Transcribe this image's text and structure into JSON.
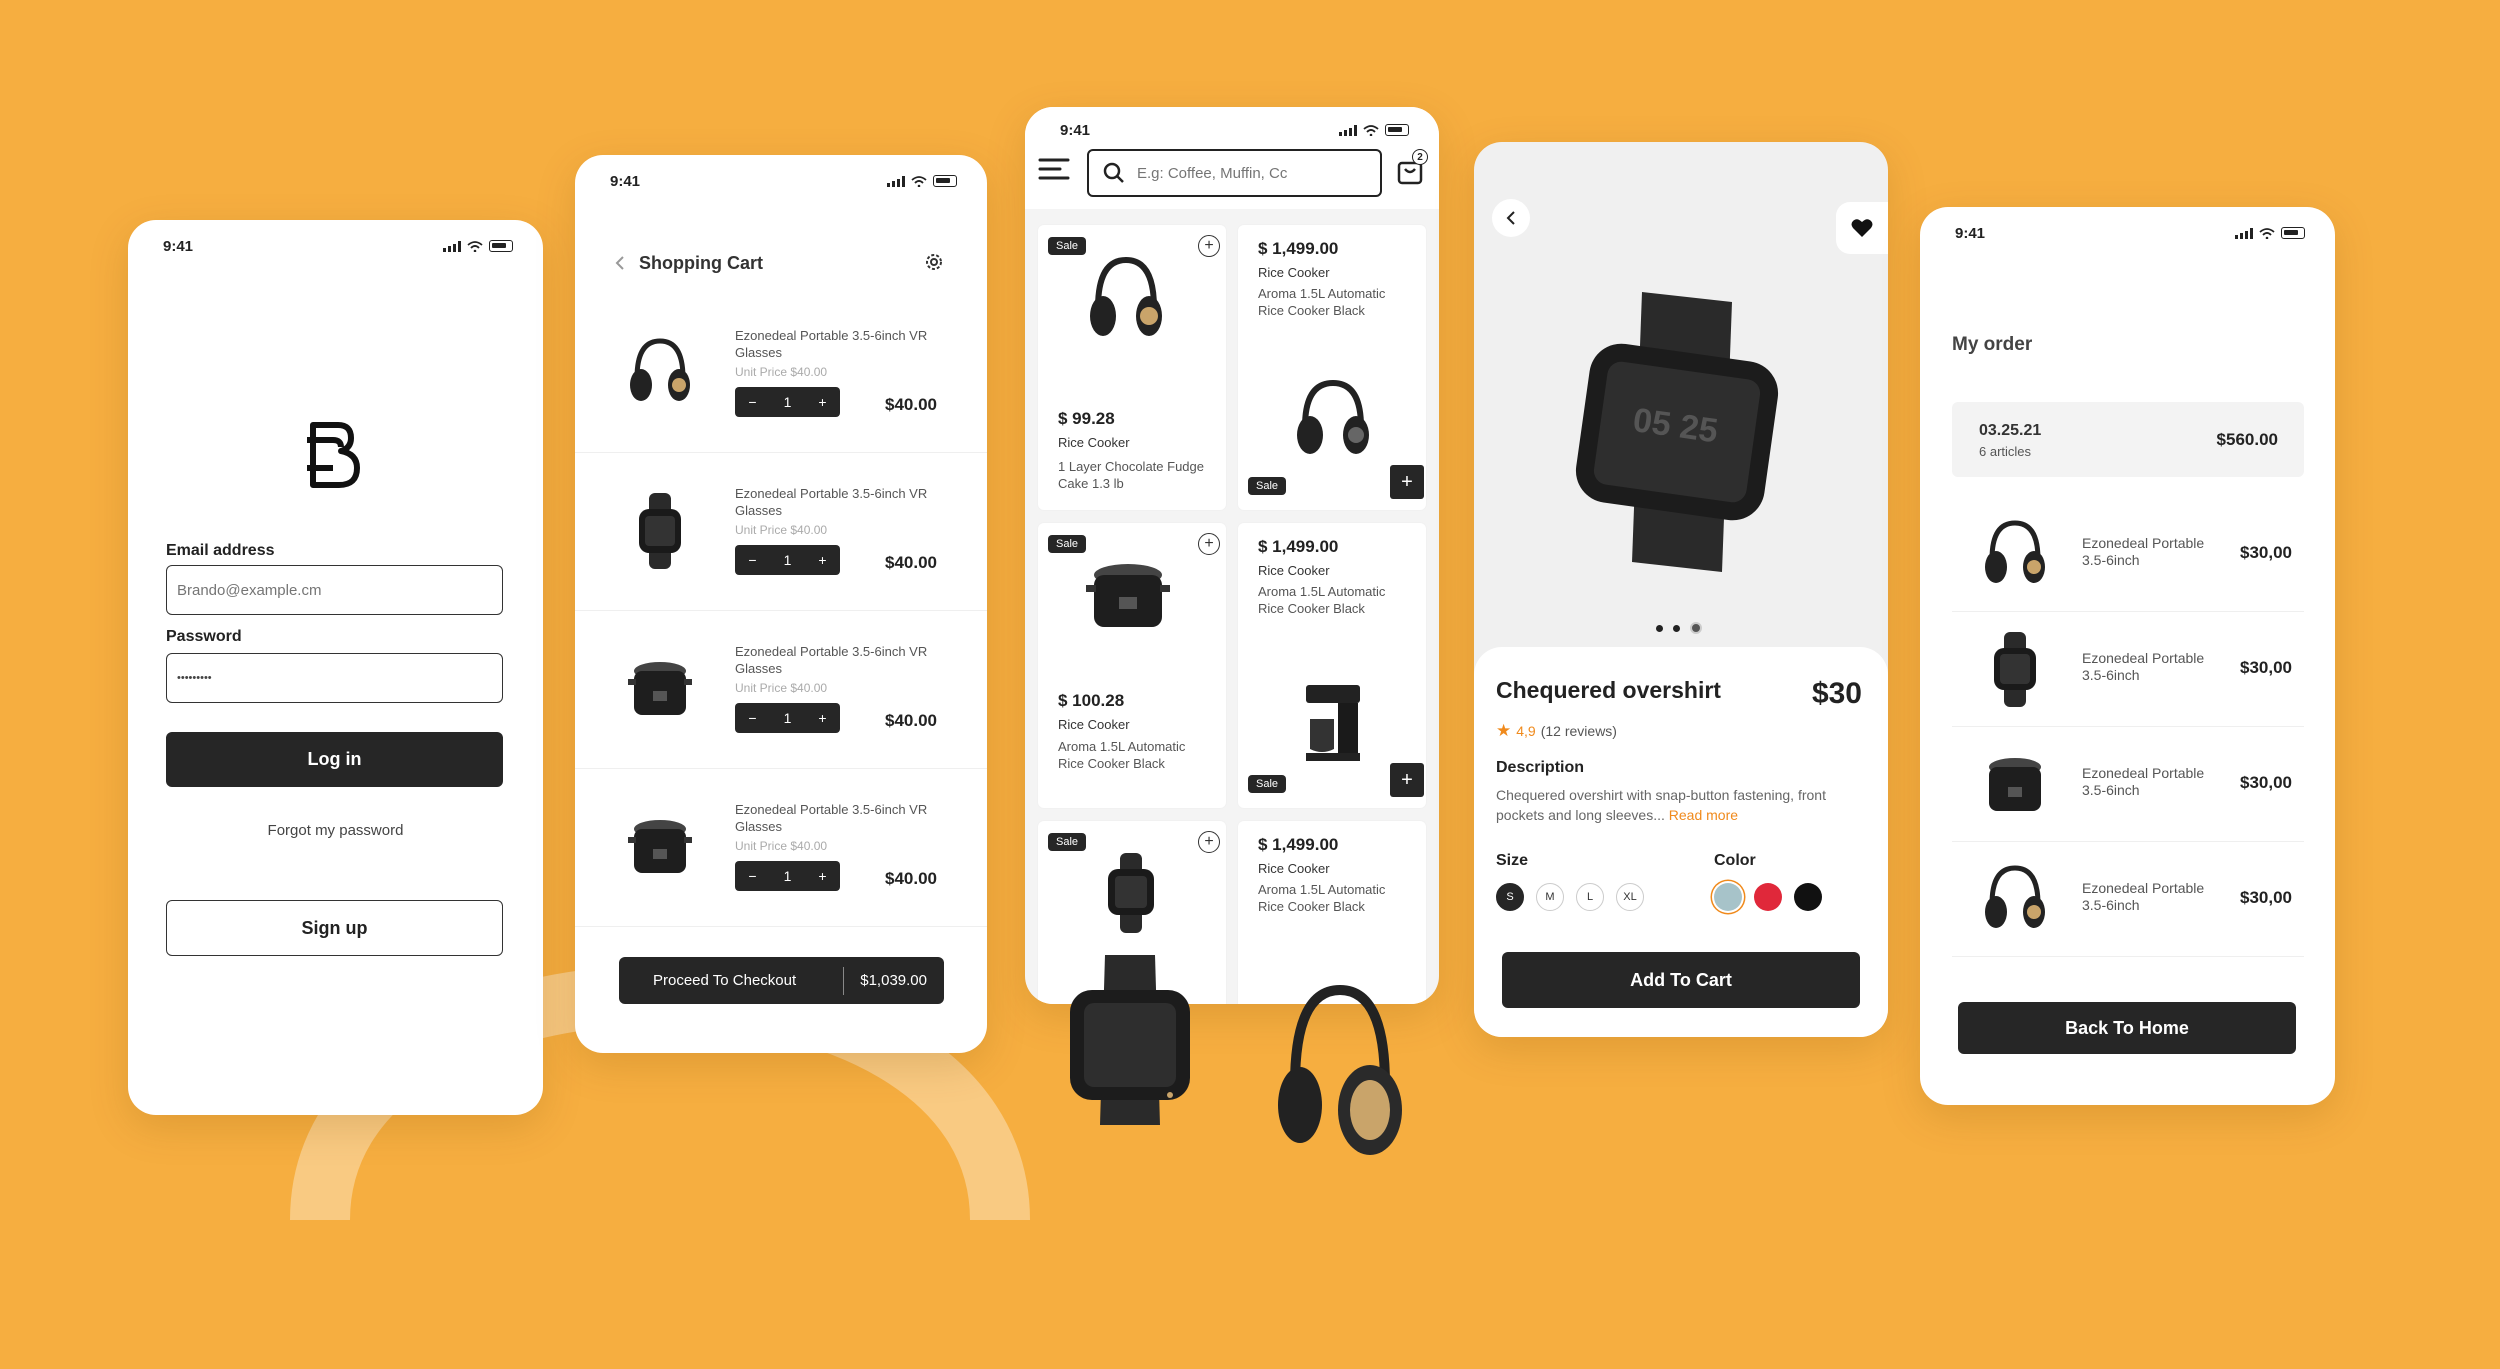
{
  "status_time": "9:41",
  "login": {
    "email_label": "Email address",
    "email_placeholder": "Brando@example.cm",
    "password_label": "Password",
    "password_value": "•••••••••",
    "login_button": "Log in",
    "forgot_link": "Forgot my password",
    "signup_button": "Sign up"
  },
  "cart": {
    "title": "Shopping Cart",
    "items": [
      {
        "name": "Ezonedeal Portable 3.5-6inch VR Glasses",
        "unit": "Unit Price $40.00",
        "qty": "1",
        "price": "$40.00",
        "thumb": "headphones"
      },
      {
        "name": "Ezonedeal Portable 3.5-6inch VR Glasses",
        "unit": "Unit Price $40.00",
        "qty": "1",
        "price": "$40.00",
        "thumb": "watch"
      },
      {
        "name": "Ezonedeal Portable 3.5-6inch VR Glasses",
        "unit": "Unit Price $40.00",
        "qty": "1",
        "price": "$40.00",
        "thumb": "rice-cooker"
      },
      {
        "name": "Ezonedeal Portable 3.5-6inch VR Glasses",
        "unit": "Unit Price $40.00",
        "qty": "1",
        "price": "$40.00",
        "thumb": "rice-cooker"
      }
    ],
    "checkout_label": "Proceed To Checkout",
    "checkout_total": "$1,039.00"
  },
  "products": {
    "search_placeholder": "E.g: Coffee, Muffin, Cc",
    "cart_badge": "2",
    "sale_label": "Sale",
    "cards": [
      {
        "price": "$ 99.28",
        "category": "Rice Cooker",
        "desc": "1 Layer Chocolate Fudge Cake 1.3 lb",
        "image": "headphones"
      },
      {
        "price": "$ 1,499.00",
        "category": "Rice Cooker",
        "desc": "Aroma 1.5L Automatic Rice Cooker Black",
        "image": "headphones"
      },
      {
        "price": "$ 100.28",
        "category": "Rice Cooker",
        "desc": "Aroma 1.5L Automatic Rice Cooker Black",
        "image": "rice-cooker"
      },
      {
        "price": "$ 1,499.00",
        "category": "Rice Cooker",
        "desc": "Aroma 1.5L Automatic Rice Cooker Black",
        "image": "coffee-maker"
      },
      {
        "price": "",
        "category": "",
        "desc": "",
        "image": "watch"
      },
      {
        "price": "$ 1,499.00",
        "category": "Rice Cooker",
        "desc": "Aroma 1.5L Automatic Rice Cooker Black",
        "image": "none"
      }
    ]
  },
  "detail": {
    "title": "Chequered overshirt",
    "price": "$30",
    "rating": "4,9",
    "reviews": "(12 reviews)",
    "description_title": "Description",
    "description": "Chequered overshirt with snap-button fastening, front pockets and long sleeves...",
    "read_more": "Read more",
    "size_title": "Size",
    "sizes": [
      "S",
      "M",
      "L",
      "XL"
    ],
    "color_title": "Color",
    "colors": [
      "#A7C3C9",
      "#E0283A",
      "#111111"
    ],
    "add_button": "Add To Cart",
    "accent": "#F08A1C"
  },
  "orders": {
    "title": "My order",
    "summary_date": "03.25.21",
    "summary_count": "6 articles",
    "summary_total": "$560.00",
    "items": [
      {
        "name": "Ezonedeal Portable 3.5-6inch",
        "price": "$30,00",
        "thumb": "headphones"
      },
      {
        "name": "Ezonedeal Portable 3.5-6inch",
        "price": "$30,00",
        "thumb": "watch"
      },
      {
        "name": "Ezonedeal Portable 3.5-6inch",
        "price": "$30,00",
        "thumb": "rice-cooker"
      },
      {
        "name": "Ezonedeal Portable 3.5-6inch",
        "price": "$30,00",
        "thumb": "headphones"
      }
    ],
    "back_button": "Back To Home"
  }
}
